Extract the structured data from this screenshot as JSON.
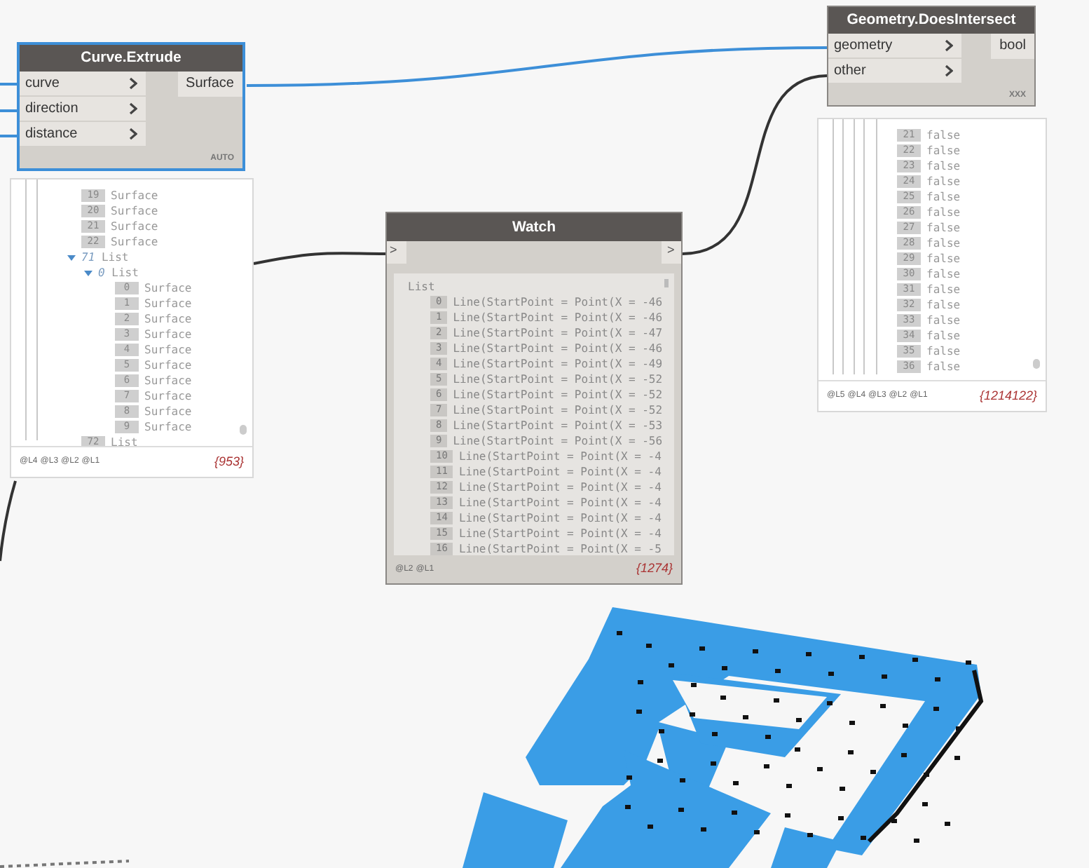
{
  "extrude_node": {
    "title": "Curve.Extrude",
    "selected": true,
    "inputs": [
      "curve",
      "direction",
      "distance"
    ],
    "output": "Surface",
    "lacing": "AUTO",
    "preview": {
      "entries": [
        {
          "index": "19",
          "value": "Surface"
        },
        {
          "index": "20",
          "value": "Surface"
        },
        {
          "index": "21",
          "value": "Surface"
        },
        {
          "index": "22",
          "value": "Surface"
        },
        {
          "index": "71",
          "value": "List",
          "expanded": true,
          "children": [
            {
              "index": "0",
              "value": "List",
              "expanded": true,
              "children": [
                {
                  "index": "0",
                  "value": "Surface"
                },
                {
                  "index": "1",
                  "value": "Surface"
                },
                {
                  "index": "2",
                  "value": "Surface"
                },
                {
                  "index": "3",
                  "value": "Surface"
                },
                {
                  "index": "4",
                  "value": "Surface"
                },
                {
                  "index": "5",
                  "value": "Surface"
                },
                {
                  "index": "6",
                  "value": "Surface"
                },
                {
                  "index": "7",
                  "value": "Surface"
                },
                {
                  "index": "8",
                  "value": "Surface"
                },
                {
                  "index": "9",
                  "value": "Surface"
                }
              ]
            }
          ]
        },
        {
          "index": "72",
          "value": "List"
        }
      ],
      "levels": [
        "@L4",
        "@L3",
        "@L2",
        "@L1"
      ],
      "count": "{953}"
    }
  },
  "watch_node": {
    "title": "Watch",
    "selected": false,
    "input": ">",
    "output": ">",
    "root": "List",
    "rows": [
      {
        "index": "0",
        "value": "Line(StartPoint = Point(X = -46"
      },
      {
        "index": "1",
        "value": "Line(StartPoint = Point(X = -46"
      },
      {
        "index": "2",
        "value": "Line(StartPoint = Point(X = -47"
      },
      {
        "index": "3",
        "value": "Line(StartPoint = Point(X = -46"
      },
      {
        "index": "4",
        "value": "Line(StartPoint = Point(X = -49"
      },
      {
        "index": "5",
        "value": "Line(StartPoint = Point(X = -52"
      },
      {
        "index": "6",
        "value": "Line(StartPoint = Point(X = -52"
      },
      {
        "index": "7",
        "value": "Line(StartPoint = Point(X = -52"
      },
      {
        "index": "8",
        "value": "Line(StartPoint = Point(X = -53"
      },
      {
        "index": "9",
        "value": "Line(StartPoint = Point(X = -56"
      },
      {
        "index": "10",
        "value": "Line(StartPoint = Point(X = -4"
      },
      {
        "index": "11",
        "value": "Line(StartPoint = Point(X = -4"
      },
      {
        "index": "12",
        "value": "Line(StartPoint = Point(X = -4"
      },
      {
        "index": "13",
        "value": "Line(StartPoint = Point(X = -4"
      },
      {
        "index": "14",
        "value": "Line(StartPoint = Point(X = -4"
      },
      {
        "index": "15",
        "value": "Line(StartPoint = Point(X = -4"
      },
      {
        "index": "16",
        "value": "Line(StartPoint = Point(X = -5"
      }
    ],
    "levels": [
      "@L2",
      "@L1"
    ],
    "count": "{1274}"
  },
  "intersect_node": {
    "title": "Geometry.DoesIntersect",
    "selected": false,
    "inputs": [
      "geometry",
      "other"
    ],
    "output": "bool",
    "lacing": "XXX",
    "preview": {
      "entries": [
        {
          "index": "21",
          "value": "false"
        },
        {
          "index": "22",
          "value": "false"
        },
        {
          "index": "23",
          "value": "false"
        },
        {
          "index": "24",
          "value": "false"
        },
        {
          "index": "25",
          "value": "false"
        },
        {
          "index": "26",
          "value": "false"
        },
        {
          "index": "27",
          "value": "false"
        },
        {
          "index": "28",
          "value": "false"
        },
        {
          "index": "29",
          "value": "false"
        },
        {
          "index": "30",
          "value": "false"
        },
        {
          "index": "31",
          "value": "false"
        },
        {
          "index": "32",
          "value": "false"
        },
        {
          "index": "33",
          "value": "false"
        },
        {
          "index": "34",
          "value": "false"
        },
        {
          "index": "35",
          "value": "false"
        },
        {
          "index": "36",
          "value": "false"
        }
      ],
      "levels": [
        "@L5",
        "@L4",
        "@L3",
        "@L2",
        "@L1"
      ],
      "count": "{1214122}"
    }
  }
}
